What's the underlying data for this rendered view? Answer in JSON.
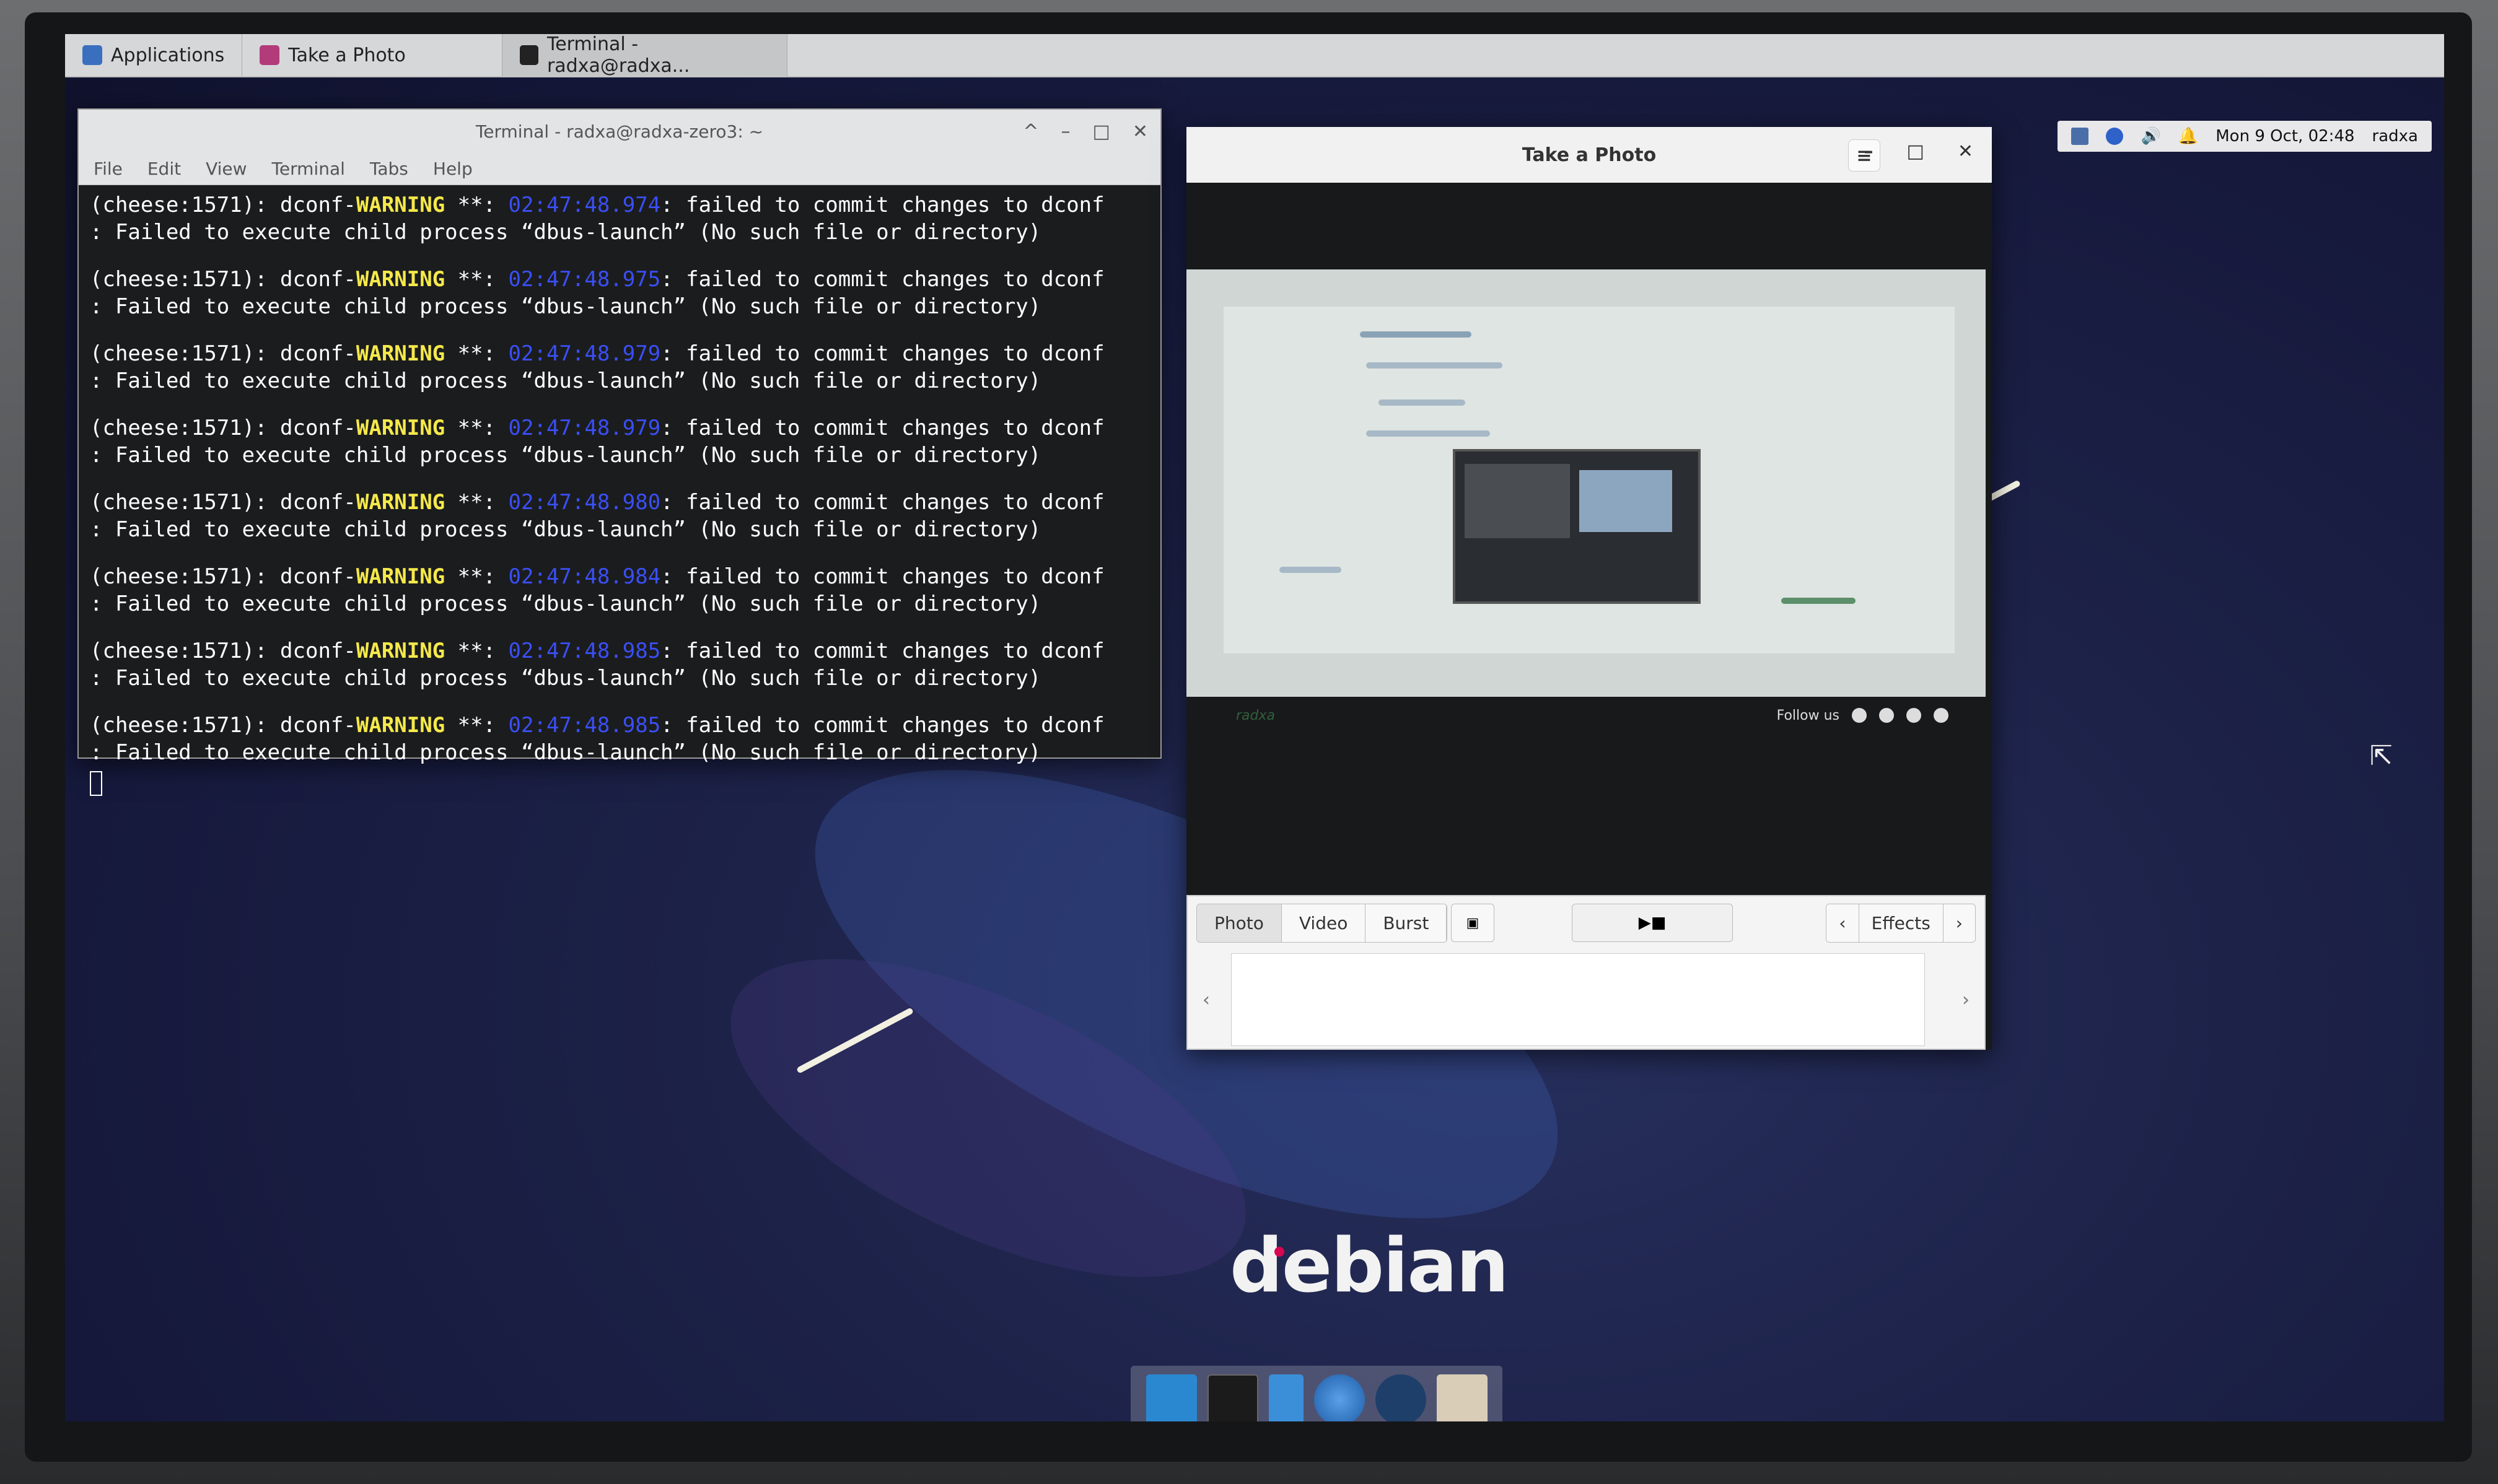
{
  "panel": {
    "applications_label": "Applications",
    "tasks": [
      {
        "label": "Take a Photo"
      },
      {
        "label": "Terminal - radxa@radxa..."
      }
    ],
    "clock": "Mon 9 Oct, 02:48",
    "user": "radxa"
  },
  "terminal": {
    "title": "Terminal - radxa@radxa-zero3: ~",
    "menu": [
      "File",
      "Edit",
      "View",
      "Terminal",
      "Tabs",
      "Help"
    ],
    "lines": [
      {
        "prefix": "(cheese:1571): dconf-",
        "level": "WARNING",
        "mid": " **: ",
        "time": "02:47:48.974",
        "msg": ": failed to commit changes to dconf",
        "detail": ": Failed to execute child process “dbus-launch” (No such file or directory)"
      },
      {
        "prefix": "(cheese:1571): dconf-",
        "level": "WARNING",
        "mid": " **: ",
        "time": "02:47:48.975",
        "msg": ": failed to commit changes to dconf",
        "detail": ": Failed to execute child process “dbus-launch” (No such file or directory)"
      },
      {
        "prefix": "(cheese:1571): dconf-",
        "level": "WARNING",
        "mid": " **: ",
        "time": "02:47:48.979",
        "msg": ": failed to commit changes to dconf",
        "detail": ": Failed to execute child process “dbus-launch” (No such file or directory)"
      },
      {
        "prefix": "(cheese:1571): dconf-",
        "level": "WARNING",
        "mid": " **: ",
        "time": "02:47:48.979",
        "msg": ": failed to commit changes to dconf",
        "detail": ": Failed to execute child process “dbus-launch” (No such file or directory)"
      },
      {
        "prefix": "(cheese:1571): dconf-",
        "level": "WARNING",
        "mid": " **: ",
        "time": "02:47:48.980",
        "msg": ": failed to commit changes to dconf",
        "detail": ": Failed to execute child process “dbus-launch” (No such file or directory)"
      },
      {
        "prefix": "(cheese:1571): dconf-",
        "level": "WARNING",
        "mid": " **: ",
        "time": "02:47:48.984",
        "msg": ": failed to commit changes to dconf",
        "detail": ": Failed to execute child process “dbus-launch” (No such file or directory)"
      },
      {
        "prefix": "(cheese:1571): dconf-",
        "level": "WARNING",
        "mid": " **: ",
        "time": "02:47:48.985",
        "msg": ": failed to commit changes to dconf",
        "detail": ": Failed to execute child process “dbus-launch” (No such file or directory)"
      },
      {
        "prefix": "(cheese:1571): dconf-",
        "level": "WARNING",
        "mid": " **: ",
        "time": "02:47:48.985",
        "msg": ": failed to commit changes to dconf",
        "detail": ": Failed to execute child process “dbus-launch” (No such file or directory)"
      }
    ]
  },
  "cheese": {
    "title": "Take a Photo",
    "modes": [
      "Photo",
      "Video",
      "Burst"
    ],
    "effects_label": "Effects",
    "preview_footer": {
      "brand": "radxa",
      "follow": "Follow us"
    }
  },
  "desktop": {
    "logo_text": "debian"
  },
  "colors": {
    "warning": "#f5e94a",
    "timestamp": "#3a4ff5",
    "debian_red": "#d70751"
  },
  "icons": [
    "terminal-icon",
    "files-icon",
    "browser-icon",
    "search-icon",
    "folder-icon",
    "bluetooth-icon",
    "volume-icon",
    "bell-icon",
    "network-icon"
  ]
}
